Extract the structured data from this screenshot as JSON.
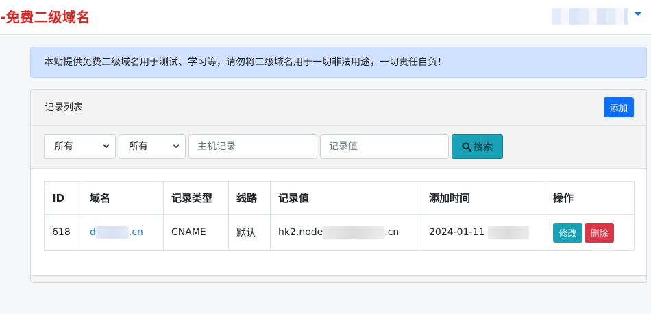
{
  "header": {
    "brand": "-免费二级域名"
  },
  "notice": {
    "text": "本站提供免费二级域名用于测试、学习等，请勿将二级域名用于一切非法用途，一切责任自负！"
  },
  "card": {
    "title": "记录列表",
    "add_label": "添加"
  },
  "filters": {
    "type_select": "所有",
    "line_select": "所有",
    "host_placeholder": "主机记录",
    "value_placeholder": "记录值",
    "search_label": "搜索"
  },
  "table": {
    "columns": [
      "ID",
      "域名",
      "记录类型",
      "线路",
      "记录值",
      "添加时间",
      "操作"
    ],
    "rows": [
      {
        "id": "618",
        "domain_prefix": "d",
        "domain_suffix": ".cn",
        "type": "CNAME",
        "line": "默认",
        "value_prefix": "hk2.node",
        "value_suffix": ".cn",
        "added": "2024-01-11",
        "edit_label": "修改",
        "delete_label": "删除"
      }
    ]
  },
  "colors": {
    "brand": "#e8231d",
    "primary": "#0d6efd",
    "info": "#17a2b8",
    "danger": "#dc3545",
    "alert_bg": "#cfe2ff"
  }
}
